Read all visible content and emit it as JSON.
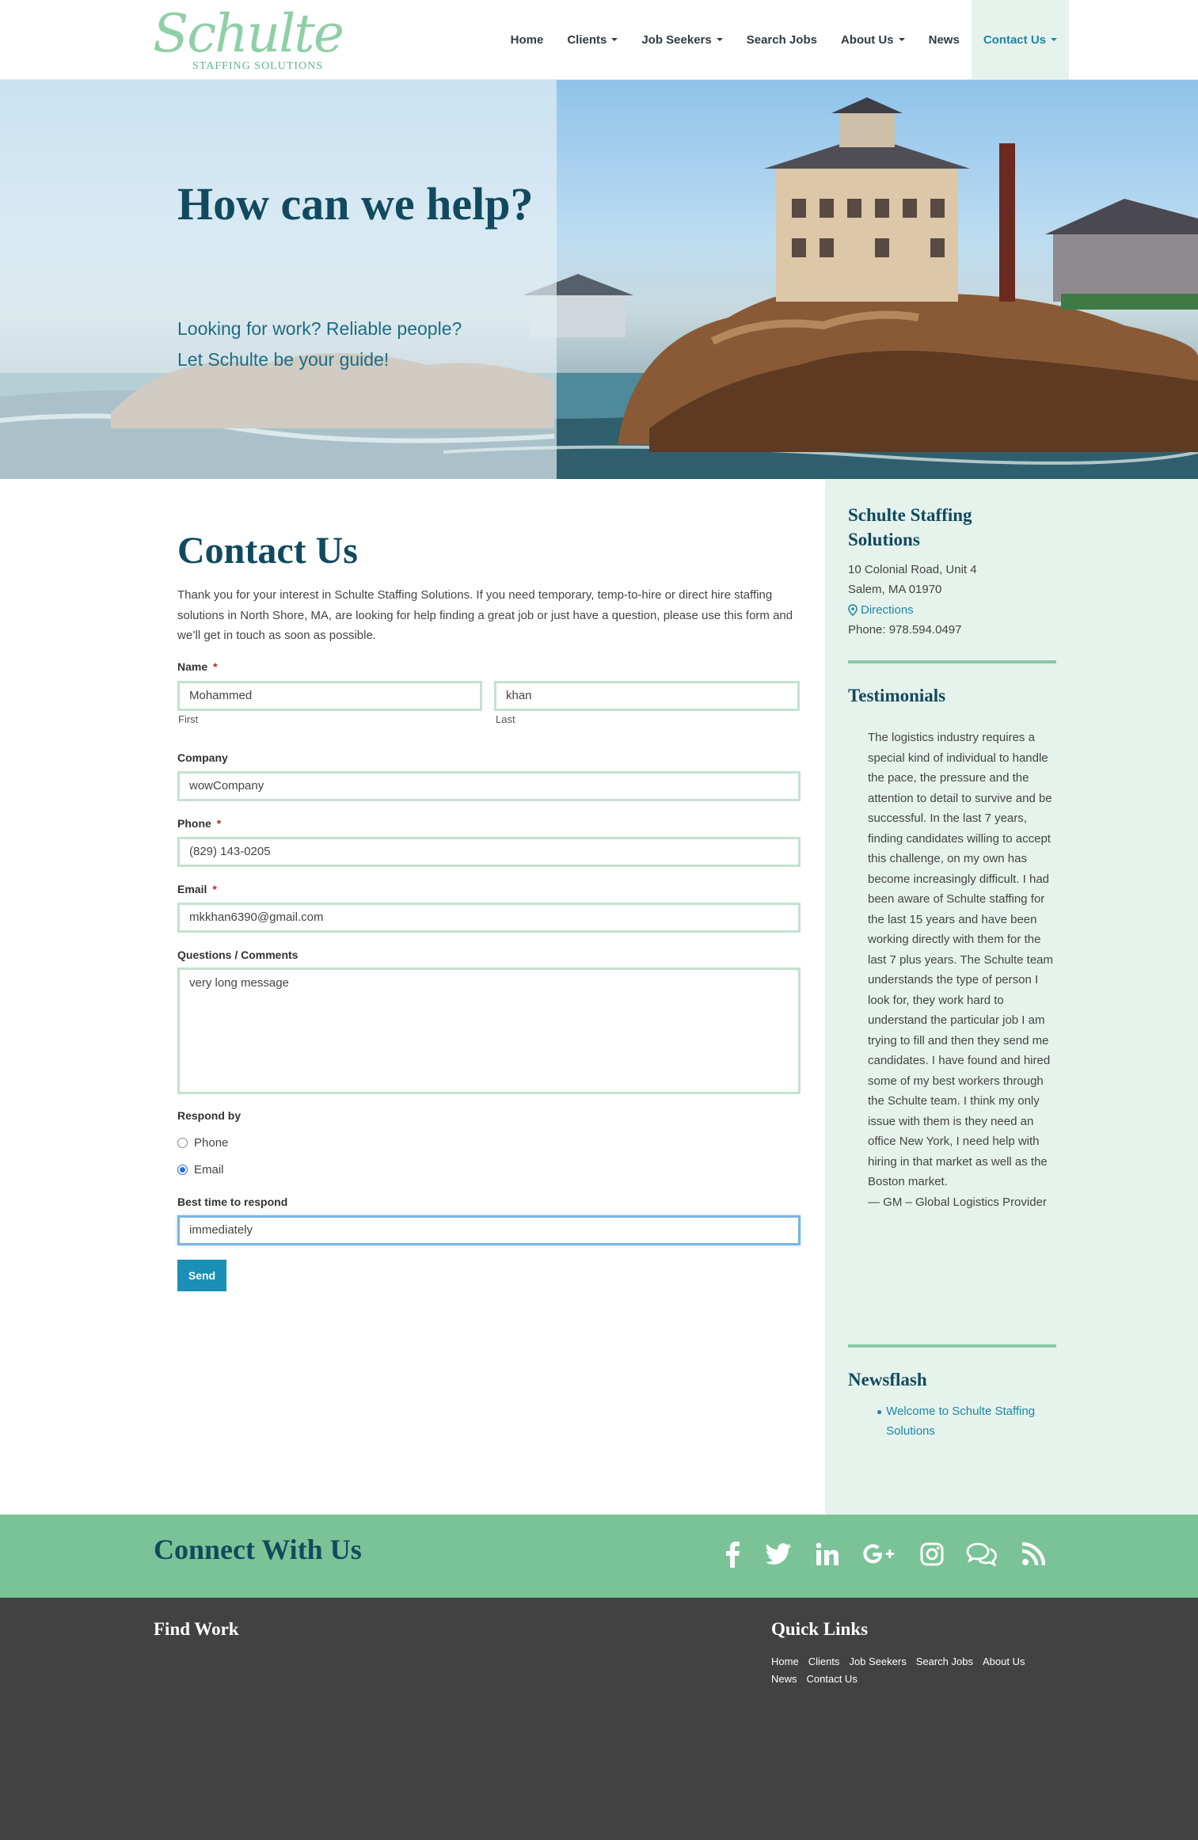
{
  "header": {
    "logo_text": "Schulte",
    "logo_sub": "STAFFING SOLUTIONS",
    "nav": [
      {
        "label": "Home"
      },
      {
        "label": "Clients"
      },
      {
        "label": "Job Seekers"
      },
      {
        "label": "Search Jobs"
      },
      {
        "label": "About Us"
      },
      {
        "label": "News"
      },
      {
        "label": "Contact Us"
      }
    ]
  },
  "hero": {
    "title": "How can we help?",
    "subtitle_line1": "Looking for work? Reliable people?",
    "subtitle_line2": "Let Schulte be your guide!"
  },
  "main": {
    "title": "Contact Us",
    "intro": "Thank you for your interest in Schulte Staffing Solutions. If you need temporary, temp-to-hire or direct hire staffing solutions in North Shore, MA, are looking for help finding a great job or just have a question, please use this form and we’ll get in touch as soon as possible.",
    "form": {
      "name_label": "Name",
      "required_mark": "*",
      "first_value": "Mohammed",
      "first_sublabel": "First",
      "last_value": "khan",
      "last_sublabel": "Last",
      "company_label": "Company",
      "company_value": "wowCompany",
      "phone_label": "Phone",
      "phone_value": "(829) 143-0205",
      "email_label": "Email",
      "email_value": "mkkhan6390@gmail.com",
      "comments_label": "Questions / Comments",
      "comments_value": "very long message",
      "respond_label": "Respond by",
      "respond_options": [
        "Phone",
        "Email"
      ],
      "respond_selected": "Email",
      "best_time_label": "Best time to respond",
      "best_time_value": "immediately",
      "send_label": "Send"
    }
  },
  "sidebar": {
    "company_title": "Schulte Staffing Solutions",
    "address1": "10 Colonial Road, Unit 4",
    "address2": "Salem, MA 01970",
    "directions": "Directions",
    "phone": "Phone: 978.594.0497",
    "testimonials_title": "Testimonials",
    "testimonial_text": "The logistics industry requires a special kind of individual to handle the pace, the pressure and the attention to detail to survive and be successful. In the last 7 years, finding candidates willing to accept this challenge, on my own has become increasingly difficult. I had been aware of Schulte staffing for the last 15 years and have been working directly with them for the last 7 plus years. The Schulte team understands the type of person I look for, they work hard to understand the particular job I am trying to fill and then they send me candidates. I have found and hired some of my best workers through the Schulte team. I think my only issue with them is they need an office New York, I need help with hiring in that market as well as the Boston market.",
    "testimonial_author": "— GM – Global Logistics Provider",
    "newsflash_title": "Newsflash",
    "news_items": [
      "Welcome to Schulte Staffing Solutions"
    ]
  },
  "connect": {
    "title": "Connect With Us",
    "icons": [
      "facebook-icon",
      "twitter-icon",
      "linkedin-icon",
      "google-plus-icon",
      "instagram-icon",
      "chat-icon",
      "rss-icon"
    ]
  },
  "footer": {
    "find_work_title": "Find Work",
    "quick_links_title": "Quick Links",
    "quick_links": [
      "Home",
      "Clients",
      "Job Seekers",
      "Search Jobs",
      "About Us",
      "News",
      "Contact Us"
    ]
  },
  "colors": {
    "brand_green": "#7ac396",
    "brand_dark": "#114a5e",
    "link": "#1d86a8",
    "sidebar_bg": "#e6f3ec",
    "footer_bg": "#424242"
  }
}
